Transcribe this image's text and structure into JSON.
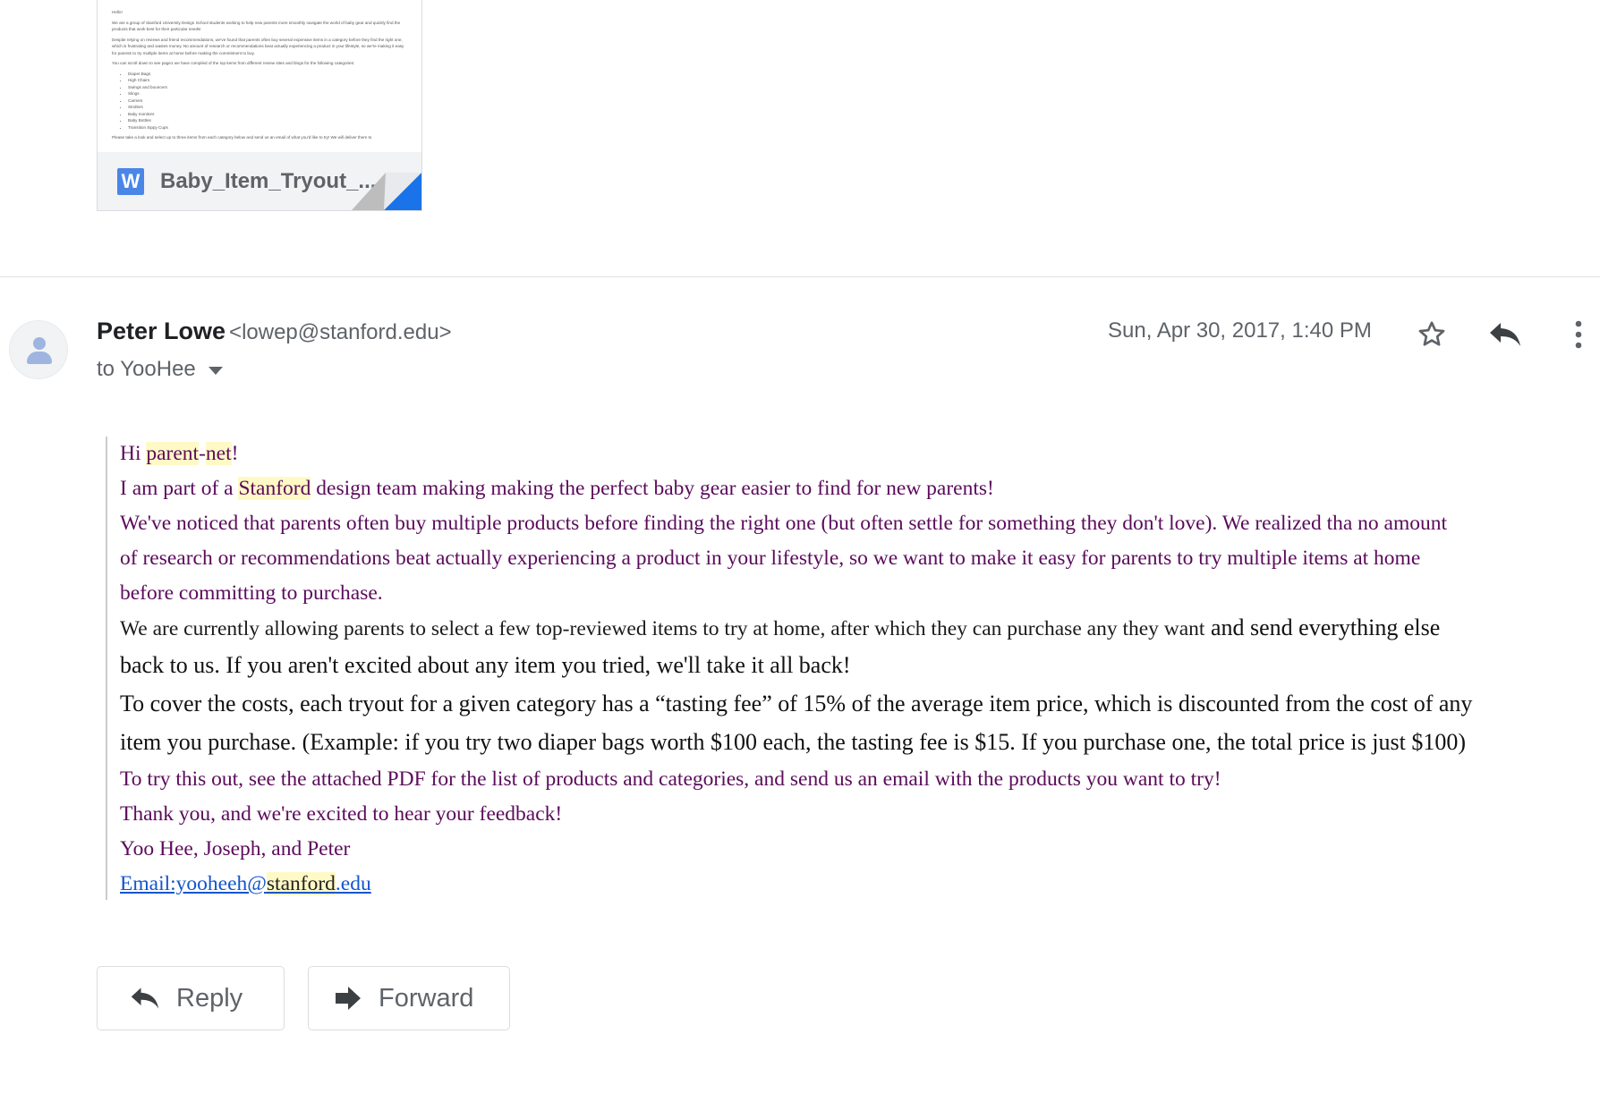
{
  "attachment": {
    "filename": "Baby_Item_Tryout_...",
    "file_icon_letter": "W",
    "preview": {
      "greeting": "Hello!",
      "para1": "We are a group of Stanford University Design School students working to help new parents more smoothly navigate the world of baby gear and quickly find the products that work best for their particular needs!",
      "para2": "Despite relying on reviews and friend recommendations, we've found that parents often buy several expensive items in a category before they find the right one, which is frustrating and wastes money.  No amount of research or recommendations beat actually experiencing a product in your lifestyle, so we're making it easy for parents to try multiple items at home before making the commitment to buy.",
      "para3": "You can scroll down to see page1 we have compiled of the top items from different review sites and blogs for the following categories:",
      "categories": [
        "Diaper Bags",
        "High Chairs",
        "Swings and bouncers",
        "Slings",
        "Carriers",
        "Strollers",
        "Baby monitors",
        "Baby Bottles",
        "Transition Sippy Cups"
      ],
      "para4": "Please take a look and select up to three items from each category below and send us an email of what you'd like to try!  We will deliver them to"
    }
  },
  "message": {
    "sender_name": "Peter Lowe",
    "sender_email": "<lowep@stanford.edu>",
    "recipient": "to YooHee",
    "date": "Sun, Apr 30, 2017, 1:40 PM"
  },
  "body": {
    "l1a": "Hi ",
    "l1b": "parent",
    "l1c": "-",
    "l1d": "net",
    "l1e": "!",
    "l2a": "I am part of a ",
    "l2b": "Stanford",
    "l2c": " design team making making the perfect baby gear easier to find for new parents!",
    "l3": " We've noticed that parents often buy multiple products before finding the right one (but often settle for something they don't love).  We realized tha no amount",
    "l4": "of research or recommendations beat actually experiencing a product in your lifestyle, so we want to make it easy for parents to try multiple items at home",
    "l5": "before committing to purchase.",
    "l6a": "We are currently allowing parents to select a few top-reviewed items to try at home, after which they can purchase any they want",
    "l6b": " and send everything else",
    "l7": "back to us.  If you aren't excited about any item you tried, we'll take it all back!",
    "l8": "To cover the costs, each tryout for a given category has a “tasting fee” of 15% of the average item price, which is discounted from the cost of any",
    "l9": "item you purchase. (Example: if you try two diaper bags worth $100 each, the tasting fee is $15. If you purchase one, the total price is just $100)",
    "l10": "To try this out, see the attached PDF for the list of products and categories, and send us an email with the products you want to try!",
    "l11": "Thank you, and we're excited to hear your feedback!",
    "l12": "Yoo Hee, Joseph, and Peter",
    "email_a": "Email:yooheeh@",
    "email_b": "stanford",
    "email_c": ".edu"
  },
  "actions": {
    "reply_label": "Reply",
    "forward_label": "Forward"
  },
  "colors": {
    "body_purple": "#5b0b5b",
    "highlight": "#fff9c6",
    "link": "#1155cc",
    "word_icon": "#4a86e8"
  }
}
